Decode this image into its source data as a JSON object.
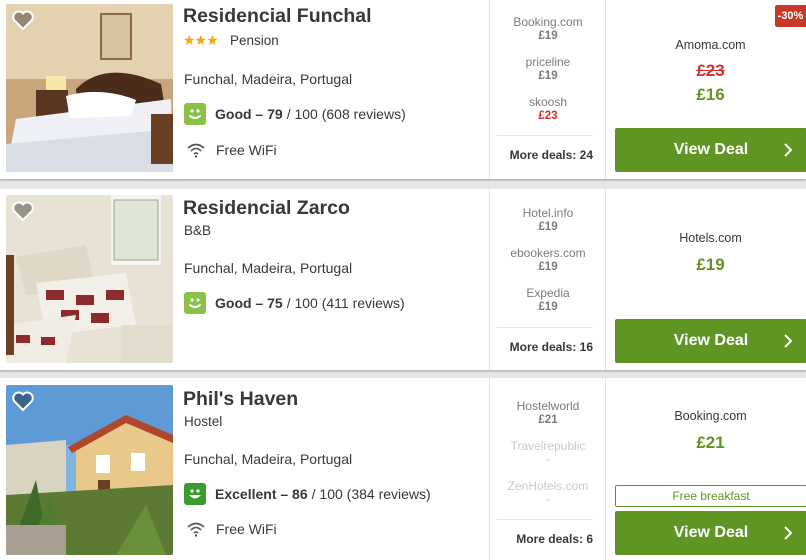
{
  "hotels": [
    {
      "name": "Residencial Funchal",
      "stars": "★★★",
      "type": "Pension",
      "location": "Funchal, Madeira, Portugal",
      "rating_label": "Good – 79",
      "rating_rest": "/ 100 (608 reviews)",
      "rating_color": "#89c149",
      "amenity": "Free WiFi",
      "deals": [
        {
          "provider": "Booking.com",
          "price": "£19"
        },
        {
          "provider": "priceline",
          "price": "£19"
        },
        {
          "provider": "skoosh",
          "price": "£23"
        }
      ],
      "more_deals": "More deals: 24",
      "discount": "-30%",
      "main_provider": "Amoma.com",
      "old_price": "£23",
      "main_price": "£16",
      "button": "View Deal"
    },
    {
      "name": "Residencial Zarco",
      "type": "B&B",
      "location": "Funchal, Madeira, Portugal",
      "rating_label": "Good – 75",
      "rating_rest": "/ 100 (411 reviews)",
      "rating_color": "#89c149",
      "deals": [
        {
          "provider": "Hotel.info",
          "price": "£19"
        },
        {
          "provider": "ebookers.com",
          "price": "£19"
        },
        {
          "provider": "Expedia",
          "price": "£19"
        }
      ],
      "more_deals": "More deals: 16",
      "main_provider": "Hotels.com",
      "main_price": "£19",
      "button": "View Deal"
    },
    {
      "name": "Phil's Haven",
      "type": "Hostel",
      "location": "Funchal, Madeira, Portugal",
      "rating_label": "Excellent – 86",
      "rating_rest": "/ 100 (384 reviews)",
      "rating_color": "#3a9b2f",
      "amenity": "Free WiFi",
      "deals": [
        {
          "provider": "Hostelworld",
          "price": "£21"
        },
        {
          "provider": "Travelrepublic",
          "price": "-"
        },
        {
          "provider": "ZenHotels.com",
          "price": "-"
        }
      ],
      "more_deals": "More deals: 6",
      "main_provider": "Booking.com",
      "main_price": "£21",
      "badge": "Free breakfast",
      "button": "View Deal"
    }
  ]
}
